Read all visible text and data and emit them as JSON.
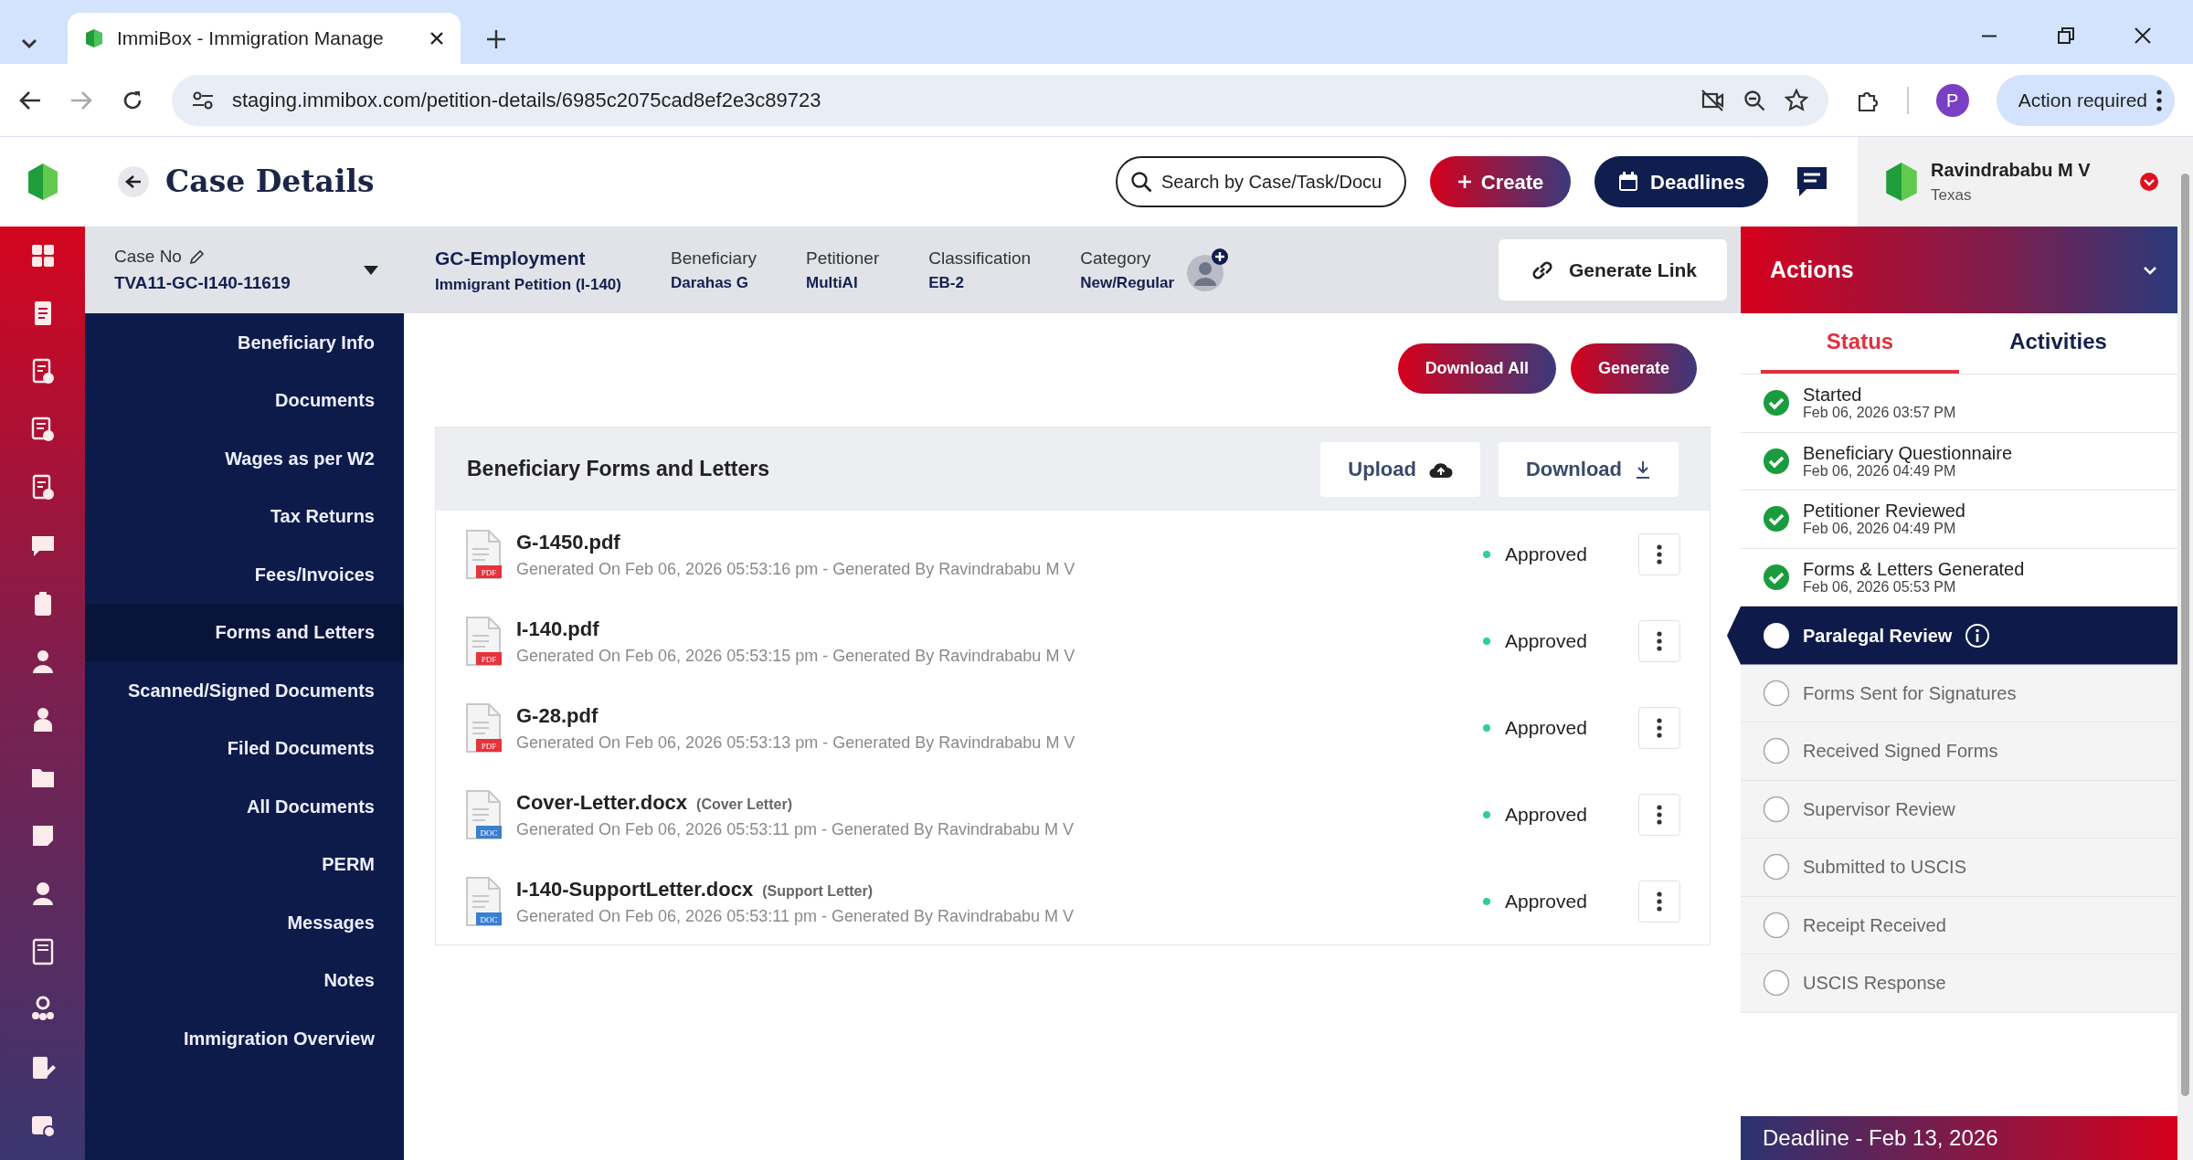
{
  "browser": {
    "tab_title": "ImmiBox - Immigration Manage",
    "url": "staging.immibox.com/petition-details/6985c2075cad8ef2e3c89723",
    "profile_initial": "P",
    "action_button": "Action required"
  },
  "header": {
    "title": "Case Details",
    "search": {
      "placeholder": "Search by Case/Task/Docu"
    },
    "create_button": "Create",
    "deadlines_button": "Deadlines",
    "user": {
      "name": "Ravindrababu M V",
      "location": "Texas"
    }
  },
  "case": {
    "case_no_label": "Case No",
    "case_no": "TVA11-GC-I140-11619",
    "type": "GC-Employment",
    "subtype": "Immigrant Petition (I-140)",
    "fields": [
      {
        "label": "Beneficiary",
        "value": "Darahas G"
      },
      {
        "label": "Petitioner",
        "value": "MultiAI"
      },
      {
        "label": "Classification",
        "value": "EB-2"
      },
      {
        "label": "Category",
        "value": "New/Regular"
      }
    ],
    "generate_link_button": "Generate Link"
  },
  "sidebar": {
    "items": [
      {
        "label": "Beneficiary Info",
        "selected": false
      },
      {
        "label": "Documents",
        "selected": false
      },
      {
        "label": "Wages as per W2",
        "selected": false
      },
      {
        "label": "Tax Returns",
        "selected": false
      },
      {
        "label": "Fees/Invoices",
        "selected": false
      },
      {
        "label": "Forms and Letters",
        "selected": true
      },
      {
        "label": "Scanned/Signed Documents",
        "selected": false
      },
      {
        "label": "Filed Documents",
        "selected": false
      },
      {
        "label": "All Documents",
        "selected": false
      },
      {
        "label": "PERM",
        "selected": false
      },
      {
        "label": "Messages",
        "selected": false
      },
      {
        "label": "Notes",
        "selected": false
      },
      {
        "label": "Immigration Overview",
        "selected": false
      }
    ]
  },
  "main": {
    "buttons": [
      "Download All",
      "Generate"
    ],
    "card": {
      "title": "Beneficiary Forms and Letters",
      "upload_button": "Upload",
      "download_button": "Download",
      "files": [
        {
          "name": "G-1450.pdf",
          "kind": "pdf",
          "badge": "PDF",
          "meta": "Generated On Feb 06, 2026 05:53:16 pm - Generated By Ravindrababu M V",
          "status": "Approved"
        },
        {
          "name": "I-140.pdf",
          "kind": "pdf",
          "badge": "PDF",
          "meta": "Generated On Feb 06, 2026 05:53:15 pm - Generated By Ravindrababu M V",
          "status": "Approved"
        },
        {
          "name": "G-28.pdf",
          "kind": "pdf",
          "badge": "PDF",
          "meta": "Generated On Feb 06, 2026 05:53:13 pm - Generated By Ravindrababu M V",
          "status": "Approved"
        },
        {
          "name": "Cover-Letter.docx",
          "tag": "(Cover Letter)",
          "kind": "doc",
          "badge": "DOC",
          "meta": "Generated On Feb 06, 2026 05:53:11 pm - Generated By Ravindrababu M V",
          "status": "Approved"
        },
        {
          "name": "I-140-SupportLetter.docx",
          "tag": "(Support Letter)",
          "kind": "doc",
          "badge": "DOC",
          "meta": "Generated On Feb 06, 2026 05:53:11 pm - Generated By Ravindrababu M V",
          "status": "Approved"
        }
      ]
    }
  },
  "actions": {
    "title": "Actions",
    "tabs": [
      {
        "label": "Status",
        "selected": true
      },
      {
        "label": "Activities",
        "selected": false
      }
    ],
    "steps": [
      {
        "label": "Started",
        "time": "Feb 06, 2026 03:57 PM",
        "checked": true,
        "selected": false
      },
      {
        "label": "Beneficiary Questionnaire",
        "time": "Feb 06, 2026 04:49 PM",
        "checked": true,
        "selected": false
      },
      {
        "label": "Petitioner Reviewed",
        "time": "Feb 06, 2026 04:49 PM",
        "checked": true,
        "selected": false
      },
      {
        "label": "Forms & Letters Generated",
        "time": "Feb 06, 2026 05:53 PM",
        "checked": true,
        "selected": false
      },
      {
        "label": "Paralegal Review",
        "checked": false,
        "selected": true
      },
      {
        "label": "Forms Sent for Signatures",
        "checked": false,
        "selected": false
      },
      {
        "label": "Received Signed Forms",
        "checked": false,
        "selected": false
      },
      {
        "label": "Supervisor Review",
        "checked": false,
        "selected": false
      },
      {
        "label": "Submitted to USCIS",
        "checked": false,
        "selected": false
      },
      {
        "label": "Receipt Received",
        "checked": false,
        "selected": false
      },
      {
        "label": "USCIS Response",
        "checked": false,
        "selected": false
      }
    ],
    "deadline": "Deadline - Feb 13, 2026"
  }
}
